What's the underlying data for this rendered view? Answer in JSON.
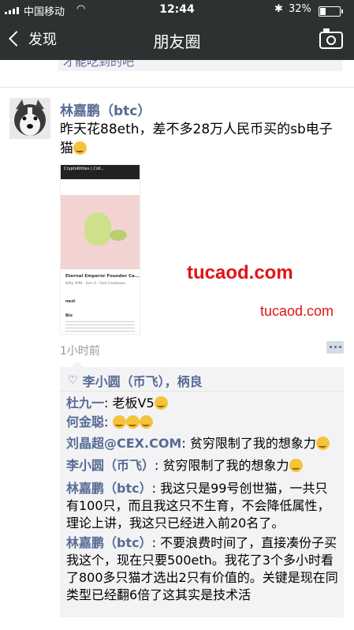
{
  "status_bar": {
    "carrier": "中国移动",
    "time": "12:44",
    "battery": "32%"
  },
  "nav": {
    "back_label": "发现",
    "title": "朋友圈"
  },
  "previous_post_fragment": "才能吃到的吧",
  "post": {
    "author": "林嘉鹏（btc）",
    "text": "昨天花88eth，差不多28万人民币买的sb电子猫",
    "time_ago": "1小时前",
    "embedded_screenshot": {
      "url_bar": "CryptoKitties | Coll...",
      "cat_title": "Eternal Emperor Founder Ca...",
      "cat_meta": "Kitty #99 · Gen 0 · Fast Cooldown",
      "owner": "next",
      "bio_label": "Bio"
    }
  },
  "watermarks": {
    "large": "tucaod.com",
    "small": "tucaod.com"
  },
  "likes": "李小圆（币飞），柄良",
  "comments": [
    {
      "who": "杜九一",
      "text": "老板V5"
    },
    {
      "who": "何金聪",
      "text": ""
    },
    {
      "who": "刘晶超@CEX.COM",
      "text": "贫穷限制了我的想象力"
    },
    {
      "who": "李小圆（币飞）",
      "text": "贫穷限制了我的想象力"
    },
    {
      "who": "林嘉鹏（btc）",
      "text": "我这只是99号创世猫，一共只有100只，而且我这只不生育，不会降低属性，理论上讲，我这只已经进入前20名了。"
    },
    {
      "who": "林嘉鹏（btc）",
      "text": "不要浪费时间了，直接凑份子买我这个，现在只要500eth。我花了3个多小时看了800多只猫才选出2只有价值的。关键是现在同类型已经翻6倍了这其实是技术活"
    }
  ],
  "colors": {
    "nav_bg": "#2e3132",
    "link": "#576b95",
    "watermark": "#e01414"
  }
}
